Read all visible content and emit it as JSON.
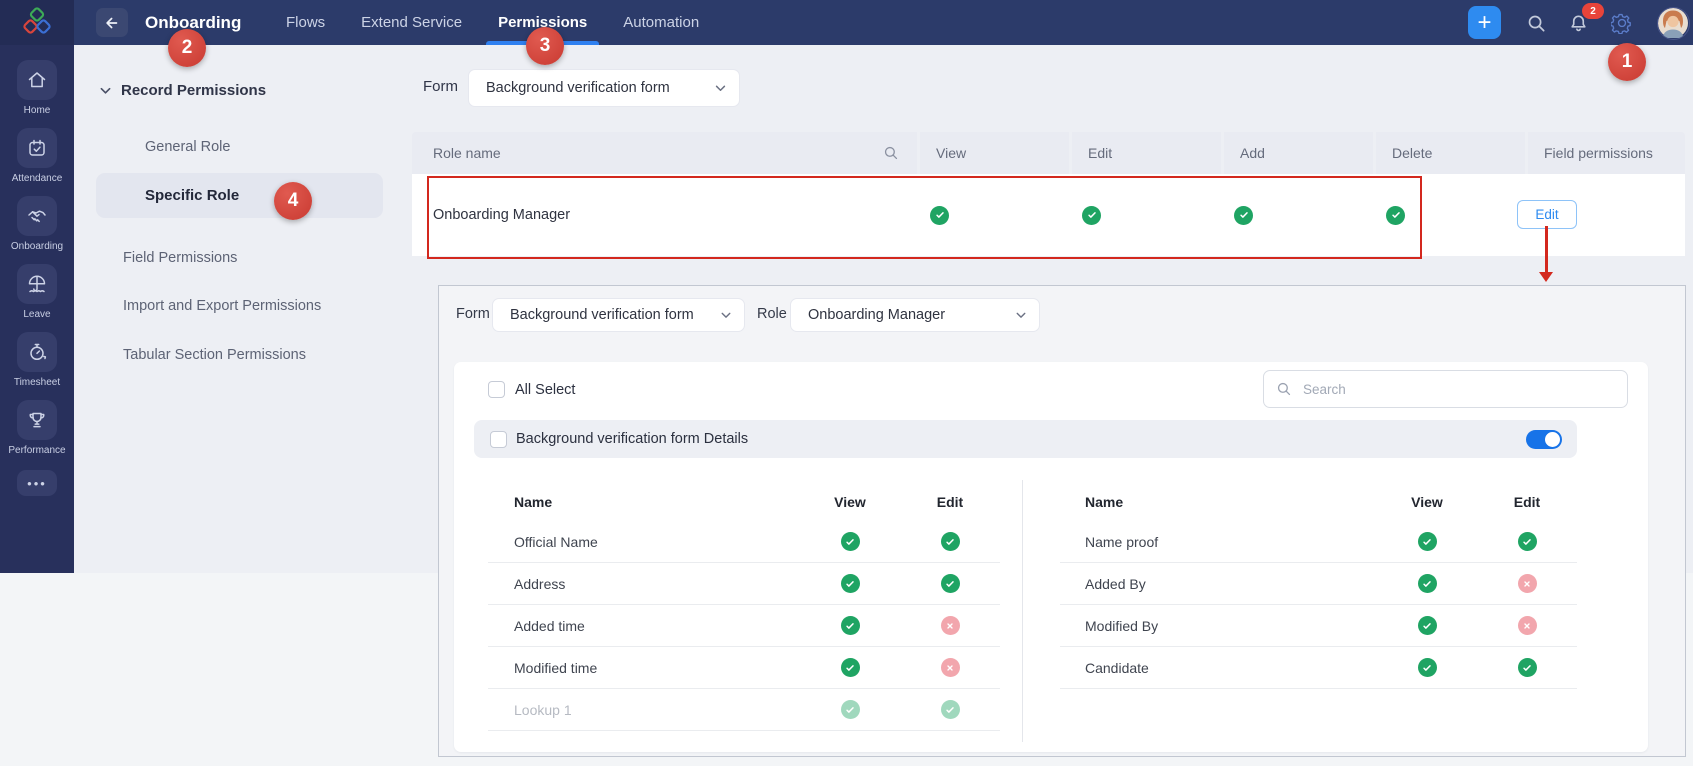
{
  "topbar": {
    "title": "Onboarding",
    "tabs": [
      "Flows",
      "Extend Service",
      "Permissions",
      "Automation"
    ],
    "active_tab": "Permissions",
    "notification_count": "2"
  },
  "sidebar": {
    "items": [
      {
        "label": "Home",
        "icon": "home-icon"
      },
      {
        "label": "Attendance",
        "icon": "attendance-calendar-icon"
      },
      {
        "label": "Onboarding",
        "icon": "onboarding-handshake-icon"
      },
      {
        "label": "Leave",
        "icon": "leave-umbrella-icon"
      },
      {
        "label": "Timesheet",
        "icon": "timesheet-clock-icon"
      },
      {
        "label": "Performance",
        "icon": "performance-trophy-icon"
      }
    ],
    "more": "•••"
  },
  "left_nav": {
    "section_label": "Record Permissions",
    "items": [
      {
        "label": "General Role",
        "selected": false
      },
      {
        "label": "Specific Role",
        "selected": true
      },
      {
        "label": "Field Permissions",
        "selected": false
      },
      {
        "label": "Import and Export Permissions",
        "selected": false
      },
      {
        "label": "Tabular Section Permissions",
        "selected": false
      }
    ]
  },
  "annotation_badges": [
    "1",
    "2",
    "3",
    "4"
  ],
  "form_selector": {
    "label": "Form",
    "value": "Background verification form"
  },
  "roles_table": {
    "columns": [
      "Role name",
      "View",
      "Edit",
      "Add",
      "Delete",
      "Field permissions"
    ],
    "rows": [
      {
        "role_name": "Onboarding Manager",
        "view": "allowed",
        "edit": "allowed",
        "add": "allowed",
        "delete": "allowed",
        "action_label": "Edit"
      }
    ]
  },
  "detail_panel": {
    "form_selector": {
      "label": "Form",
      "value": "Background verification form"
    },
    "role_selector": {
      "label": "Role",
      "value": "Onboarding Manager"
    },
    "all_select_label": "All Select",
    "search_placeholder": "Search",
    "section": {
      "title": "Background verification form Details",
      "toggle": "on"
    },
    "list_headers": {
      "name": "Name",
      "view": "View",
      "edit": "Edit"
    },
    "left_fields": [
      {
        "name": "Official Name",
        "view": "allowed",
        "edit": "allowed",
        "disabled": false
      },
      {
        "name": "Address",
        "view": "allowed",
        "edit": "allowed",
        "disabled": false
      },
      {
        "name": "Added time",
        "view": "allowed",
        "edit": "denied",
        "disabled": false
      },
      {
        "name": "Modified time",
        "view": "allowed",
        "edit": "denied",
        "disabled": false
      },
      {
        "name": "Lookup 1",
        "view": "allowed",
        "edit": "allowed",
        "disabled": true
      }
    ],
    "right_fields": [
      {
        "name": "Name proof",
        "view": "allowed",
        "edit": "allowed",
        "disabled": false
      },
      {
        "name": "Added By",
        "view": "allowed",
        "edit": "denied",
        "disabled": false
      },
      {
        "name": "Modified By",
        "view": "allowed",
        "edit": "denied",
        "disabled": false
      },
      {
        "name": "Candidate",
        "view": "allowed",
        "edit": "allowed",
        "disabled": false
      }
    ]
  },
  "colors": {
    "allowed_green": "#1fa463",
    "denied_pink": "#f2a6ad",
    "annotation_red": "#d6453c",
    "highlight_red": "#d3281e",
    "accent_blue": "#2e8bf0",
    "toggle_blue": "#1773e8",
    "topbar_navy": "#2c3b6a"
  }
}
